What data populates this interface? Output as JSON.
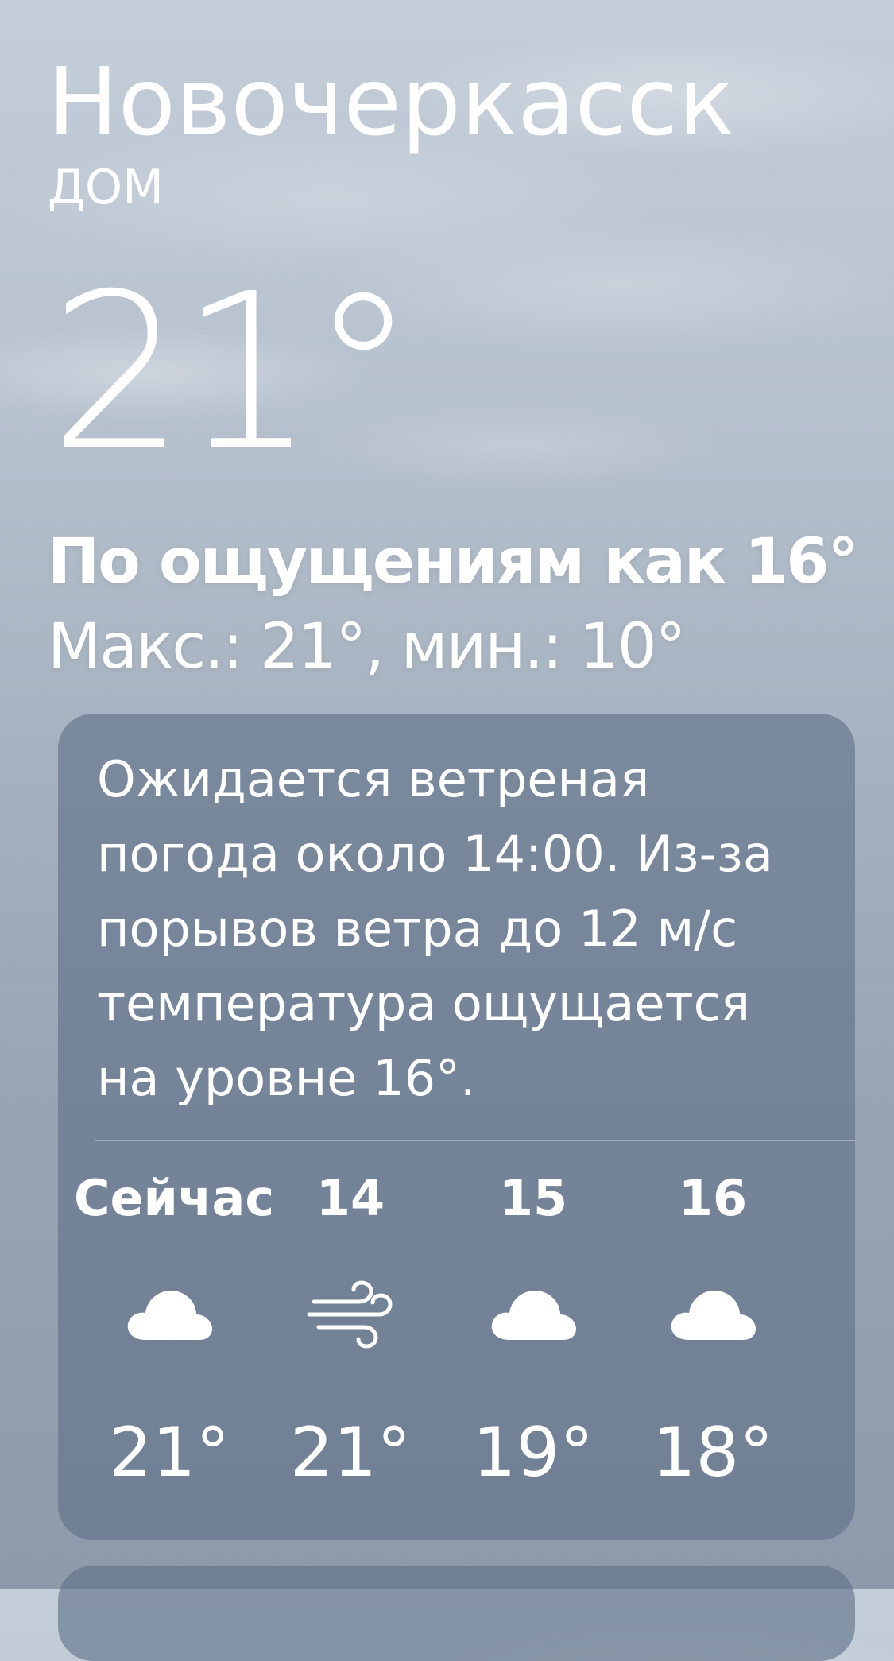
{
  "location": {
    "city": "Новочеркасск",
    "label": "ДОМ"
  },
  "current": {
    "temperature": "21°",
    "feels_like": "По ощущениям как 16°",
    "max_min": "Макс.: 21°, мин.: 10°"
  },
  "forecast": {
    "summary": "Ожидается ветреная\nпогода около 14:00. Из-за\nпорывов ветра до 12 м/с\nтемпература ощущается\nна уровне 16°.",
    "hours": [
      {
        "label": "Сейчас",
        "icon": "cloud-icon",
        "temp": "21°"
      },
      {
        "label": "14",
        "icon": "wind-icon",
        "temp": "21°"
      },
      {
        "label": "15",
        "icon": "cloud-icon",
        "temp": "19°"
      },
      {
        "label": "16",
        "icon": "cloud-icon",
        "temp": "18°"
      }
    ]
  },
  "colors": {
    "text": "#ffffff",
    "card_bg": "#607088"
  }
}
